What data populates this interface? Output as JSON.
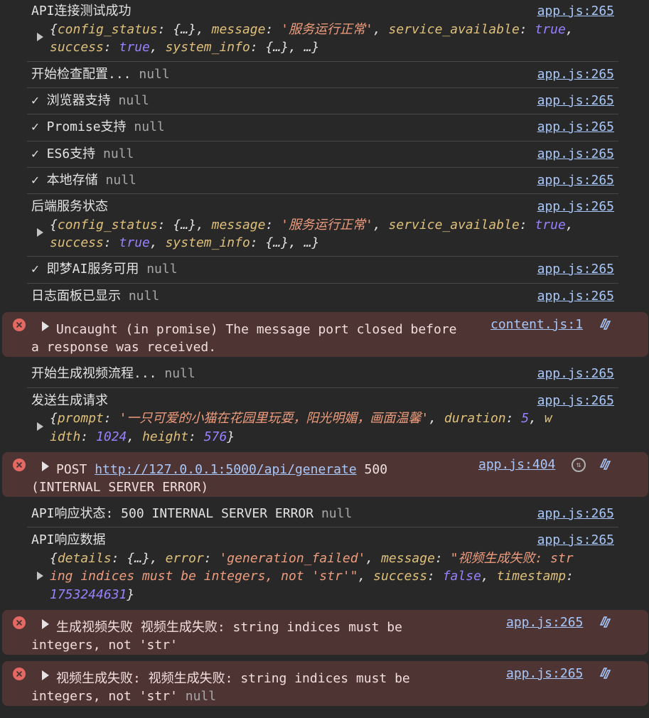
{
  "rows": {
    "api_ok": {
      "label": "API连接测试成功",
      "source": "app.js:265",
      "obj1": {
        "k1": "config_status",
        "v1": "{…}",
        "k2": "message",
        "v2": "'服务运行正常'",
        "k3": "service_available",
        "v3": "true"
      },
      "obj2": {
        "k1": "success",
        "v1": "true",
        "k2": "system_info",
        "v2": "{…}",
        "tail": "…}"
      }
    },
    "check_config": {
      "label": "开始检查配置...",
      "null": "null",
      "source": "app.js:265"
    },
    "browser": {
      "label": "✓ 浏览器支持",
      "null": "null",
      "source": "app.js:265"
    },
    "promise": {
      "label": "✓ Promise支持",
      "null": "null",
      "source": "app.js:265"
    },
    "es6": {
      "label": "✓ ES6支持",
      "null": "null",
      "source": "app.js:265"
    },
    "storage": {
      "label": "✓ 本地存储",
      "null": "null",
      "source": "app.js:265"
    },
    "backend": {
      "label": "后端服务状态",
      "source": "app.js:265",
      "obj1": {
        "k1": "config_status",
        "v1": "{…}",
        "k2": "message",
        "v2": "'服务运行正常'",
        "k3": "service_available",
        "v3": "true"
      },
      "obj2": {
        "k1": "success",
        "v1": "true",
        "k2": "system_info",
        "v2": "{…}",
        "tail": "…}"
      }
    },
    "jimeng": {
      "label": "✓ 即梦AI服务可用",
      "null": "null",
      "source": "app.js:265"
    },
    "panel": {
      "label": "日志面板已显示",
      "null": "null",
      "source": "app.js:265"
    },
    "err_port": {
      "line1": "Uncaught (in promise) The message port closed before",
      "line2": "a response was received.",
      "source": "content.js:1"
    },
    "start_gen": {
      "label": "开始生成视频流程...",
      "null": "null",
      "source": "app.js:265"
    },
    "send_req": {
      "label": "发送生成请求",
      "source": "app.js:265",
      "k1": "prompt",
      "v1": "'一只可爱的小猫在花园里玩耍，阳光明媚，画面温馨'",
      "k2": "duration",
      "v2": "5",
      "w": "w",
      "k3": "idth",
      "v3": "1024",
      "k4": "height",
      "v4": "576"
    },
    "err_post": {
      "method": "POST",
      "url": "http://127.0.0.1:5000/api/generate",
      "code": "500",
      "line2": "(INTERNAL SERVER ERROR)",
      "source": "app.js:404"
    },
    "api_status": {
      "label": "API响应状态: 500 INTERNAL SERVER ERROR",
      "null": "null",
      "source": "app.js:265"
    },
    "api_data": {
      "label": "API响应数据",
      "source": "app.js:265",
      "k1": "details",
      "v1": "{…}",
      "k2": "error",
      "v2": "'generation_failed'",
      "k3": "message",
      "v3a": "\"视频生成失败: str",
      "v3b": "ing indices must be integers, not 'str'\"",
      "k4": "success",
      "v4": "false",
      "k5": "timestamp",
      "v5": "1753244631"
    },
    "err_gen1": {
      "line1": "生成视频失败 视频生成失败: string indices must be",
      "line2": "integers, not 'str'",
      "source": "app.js:265"
    },
    "err_gen2": {
      "line1": "视频生成失败: 视频生成失败: string indices must be",
      "line2": "integers, not 'str'",
      "null": "null",
      "source": "app.js:265"
    }
  },
  "colors": {
    "background": "#282828",
    "error_bg": "#4e3534",
    "link": "#a8c7fa",
    "key": "#dfc07a",
    "string": "#ee9c7d",
    "bool": "#9980ff"
  },
  "icons": [
    "error-icon",
    "expand-triangle-icon",
    "ai-assist-icon",
    "network-request-icon"
  ]
}
